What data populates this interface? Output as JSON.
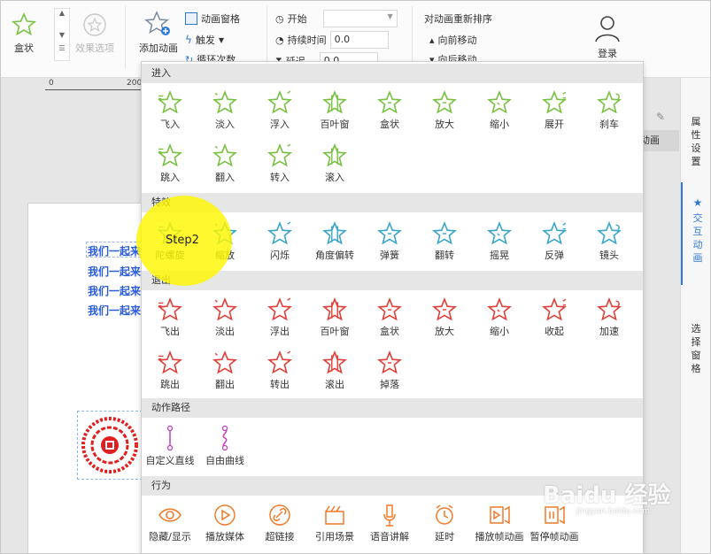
{
  "ribbon": {
    "box_effect_label": "盒状",
    "effect_options_label": "效果选项",
    "add_animation_label": "添加动画",
    "animation_pane_label": "动画窗格",
    "trigger_label": "触发",
    "loop_label": "循环次数",
    "start_label": "开始",
    "duration_label": "持续时间",
    "duration_value": "0.0",
    "delay_label": "延迟",
    "delay_value": "0.0",
    "reorder_label": "对动画重新排序",
    "move_forward_label": "向前移动",
    "move_backward_label": "向后移动",
    "user_label": "登录"
  },
  "ruler": {
    "start": "0",
    "mark": "200"
  },
  "slide": {
    "text_lines": [
      "我们一起来",
      "我们一起来",
      "我们一起来",
      "我们一起来"
    ],
    "animation_tab_label": "动画"
  },
  "right_panel": {
    "tabs": [
      "属性设置",
      "交互动画",
      "选择窗格"
    ]
  },
  "popup": {
    "sections": {
      "enter": "进入",
      "emphasis": "特效",
      "exit": "退出",
      "path": "动作路径",
      "behavior": "行为"
    },
    "enter_items": [
      "飞入",
      "淡入",
      "浮入",
      "百叶窗",
      "盒状",
      "放大",
      "缩小",
      "展开",
      "刹车",
      "跳入",
      "翻入",
      "转入",
      "滚入"
    ],
    "emphasis_items": [
      "陀螺旋",
      "缩放",
      "闪烁",
      "角度偏转",
      "弹簧",
      "翻转",
      "摇晃",
      "反弹",
      "镜头"
    ],
    "exit_items": [
      "飞出",
      "淡出",
      "浮出",
      "百叶窗",
      "盒状",
      "放大",
      "缩小",
      "收起",
      "加速",
      "跳出",
      "翻出",
      "转出",
      "滚出",
      "掉落"
    ],
    "path_items": [
      "自定义直线",
      "自由曲线"
    ],
    "behavior_items": [
      "隐藏/显示",
      "播放媒体",
      "超链接",
      "引用场景",
      "语音讲解",
      "延时",
      "播放帧动画",
      "暂停帧动画"
    ]
  },
  "annotation": {
    "step_label": "Step2"
  },
  "watermark": {
    "brand": "Baidu 经验",
    "url": "jingyan.baidu.com"
  },
  "colors": {
    "enter": "#7ac143",
    "emphasis": "#3aa6c8",
    "exit": "#e0403a",
    "path": "#c23fbf",
    "behavior": "#f07a2a",
    "accent": "#2f7ad8",
    "text_blue": "#2a5cdb"
  }
}
